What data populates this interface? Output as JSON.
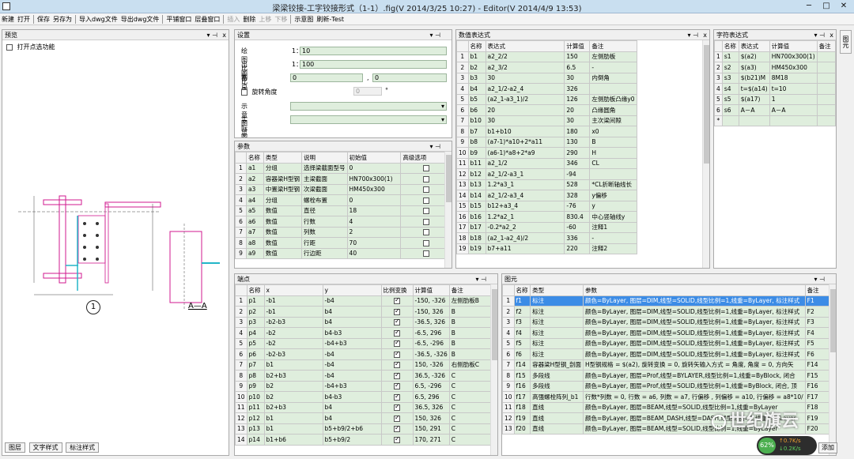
{
  "window": {
    "title": "梁梁铰接-工字铰接形式（1-1）.fig(V 2014/3/25 10:27) - Editor(V 2014/4/9 13:53)"
  },
  "menu": {
    "items": [
      {
        "label": "新建",
        "enabled": true
      },
      {
        "label": "打开",
        "enabled": true
      },
      {
        "sep": true
      },
      {
        "label": "保存",
        "enabled": true
      },
      {
        "label": "另存为",
        "enabled": true
      },
      {
        "sep": true
      },
      {
        "label": "导入dwg文件",
        "enabled": true
      },
      {
        "label": "导出dwg文件",
        "enabled": true
      },
      {
        "sep": true
      },
      {
        "label": "平铺窗口",
        "enabled": true
      },
      {
        "label": "层叠窗口",
        "enabled": true
      },
      {
        "sep": true
      },
      {
        "label": "插入",
        "enabled": false
      },
      {
        "label": "删除",
        "enabled": true
      },
      {
        "label": "上移",
        "enabled": false
      },
      {
        "label": "下移",
        "enabled": false
      },
      {
        "sep": true
      },
      {
        "label": "示意图",
        "enabled": true
      },
      {
        "label": "刷新-Test",
        "enabled": true
      }
    ]
  },
  "preview": {
    "title": "预览",
    "checkbox_label": "打开点选功能",
    "left_caption": "1",
    "right_caption": "A—A",
    "bottom_tabs": [
      "图层",
      "文字样式",
      "标注样式"
    ]
  },
  "settings": {
    "title": "设置",
    "draw_scale_label": "绘图比例",
    "draw_scale_prefix": "1：",
    "draw_scale_value": "10",
    "out_scale_label": "出图比例",
    "out_scale_prefix": "1：",
    "out_scale_value": "100",
    "base_label": "基点",
    "base_x": "0",
    "base_sep": ",",
    "base_y": "0",
    "rotate_label": "旋转角度",
    "rotate_value": "0",
    "rotate_unit": "°",
    "schematic_label": "示意图显示编号",
    "actual_label": "实际图显示编号"
  },
  "params": {
    "title": "参数",
    "columns": [
      "名称",
      "类型",
      "说明",
      "初始值",
      "高级选项"
    ],
    "rows": [
      [
        "1",
        "a1",
        "分组",
        "选择梁截面型号",
        "0"
      ],
      [
        "2",
        "a2",
        "容器梁H型钢",
        "主梁截面",
        "HN700x300(1)"
      ],
      [
        "3",
        "a3",
        "中置梁H型钢",
        "次梁截面",
        "HM450x300"
      ],
      [
        "4",
        "a4",
        "分组",
        "螺栓布置",
        "0"
      ],
      [
        "5",
        "a5",
        "数值",
        "直径",
        "18"
      ],
      [
        "6",
        "a6",
        "数值",
        "行数",
        "4"
      ],
      [
        "7",
        "a7",
        "数值",
        "列数",
        "2"
      ],
      [
        "8",
        "a8",
        "数值",
        "行距",
        "70"
      ],
      [
        "9",
        "a9",
        "数值",
        "行边距",
        "40"
      ]
    ]
  },
  "numexpr": {
    "title": "数值表达式",
    "columns": [
      "名称",
      "表达式",
      "计算值",
      "备注"
    ],
    "rows": [
      [
        "1",
        "b1",
        "a2_2/2",
        "150",
        "左侧肋板"
      ],
      [
        "2",
        "b2",
        "a2_3/2",
        "6.5",
        "-"
      ],
      [
        "3",
        "b3",
        "30",
        "30",
        "内倒角"
      ],
      [
        "4",
        "b4",
        "a2_1/2-a2_4",
        "326",
        ""
      ],
      [
        "5",
        "b5",
        "(a2_1-a3_1)/2",
        "126",
        "左侧肋板凸缘y0"
      ],
      [
        "6",
        "b6",
        "20",
        "20",
        "凸缘圆角"
      ],
      [
        "7",
        "b10",
        "30",
        "30",
        "主次梁间隙"
      ],
      [
        "8",
        "b7",
        "b1+b10",
        "180",
        "x0"
      ],
      [
        "9",
        "b8",
        "(a7-1)*a10+2*a11",
        "130",
        "B"
      ],
      [
        "10",
        "b9",
        "(a6-1)*a8+2*a9",
        "290",
        "H"
      ],
      [
        "11",
        "b11",
        "a2_1/2",
        "346",
        "CL"
      ],
      [
        "12",
        "b12",
        "a2_1/2-a3_1",
        "-94",
        ""
      ],
      [
        "13",
        "b13",
        "1.2*a3_1",
        "528",
        "*CL折断轴线长"
      ],
      [
        "14",
        "b14",
        "a2_1/2-a3_4",
        "328",
        "y偏移"
      ],
      [
        "15",
        "b15",
        "b12+a3_4",
        "-76",
        "y"
      ],
      [
        "16",
        "b16",
        "1.2*a2_1",
        "830.4",
        "中心竖轴线y"
      ],
      [
        "17",
        "b17",
        "-0.2*a2_2",
        "-60",
        "注释1"
      ],
      [
        "18",
        "b18",
        "(a2_1-a2_4)/2",
        "336",
        "-"
      ],
      [
        "19",
        "b19",
        "b7+a11",
        "220",
        "注释2"
      ]
    ]
  },
  "strexpr": {
    "title": "字符表达式",
    "columns": [
      "名称",
      "表达式",
      "计算值",
      "备注"
    ],
    "rows": [
      [
        "1",
        "s1",
        "$(a2)",
        "HN700x300(1)",
        ""
      ],
      [
        "2",
        "s2",
        "$(a3)",
        "HM450x300",
        ""
      ],
      [
        "3",
        "s3",
        "$(b21)M",
        "8M18",
        ""
      ],
      [
        "4",
        "s4",
        "t=$(a14)",
        "t=10",
        ""
      ],
      [
        "5",
        "s5",
        "$(a17)",
        "1",
        ""
      ],
      [
        "6",
        "s6",
        "A－A",
        "A－A",
        ""
      ],
      [
        "*",
        "",
        "",
        "",
        ""
      ]
    ]
  },
  "side_tab": {
    "label": "图元"
  },
  "points": {
    "title": "端点",
    "columns": [
      "名称",
      "x",
      "y",
      "比例变换",
      "计算值",
      "备注"
    ],
    "rows": [
      [
        "1",
        "p1",
        "-b1",
        "-b4",
        true,
        "-150, -326",
        "左侧肋板B"
      ],
      [
        "2",
        "p2",
        "-b1",
        "b4",
        true,
        "-150, 326",
        "B"
      ],
      [
        "3",
        "p3",
        "-b2-b3",
        "b4",
        true,
        "-36.5, 326",
        "B"
      ],
      [
        "4",
        "p4",
        "-b2",
        "b4-b3",
        true,
        "-6.5, 296",
        "B"
      ],
      [
        "5",
        "p5",
        "-b2",
        "-b4+b3",
        true,
        "-6.5, -296",
        "B"
      ],
      [
        "6",
        "p6",
        "-b2-b3",
        "-b4",
        true,
        "-36.5, -326",
        "B"
      ],
      [
        "7",
        "p7",
        "b1",
        "-b4",
        true,
        "150, -326",
        "右侧肋板C"
      ],
      [
        "8",
        "p8",
        "b2+b3",
        "-b4",
        true,
        "36.5, -326",
        "C"
      ],
      [
        "9",
        "p9",
        "b2",
        "-b4+b3",
        true,
        "6.5, -296",
        "C"
      ],
      [
        "10",
        "p10",
        "b2",
        "b4-b3",
        true,
        "6.5, 296",
        "C"
      ],
      [
        "11",
        "p11",
        "b2+b3",
        "b4",
        true,
        "36.5, 326",
        "C"
      ],
      [
        "12",
        "p12",
        "b1",
        "b4",
        true,
        "150, 326",
        "C"
      ],
      [
        "13",
        "p13",
        "b1",
        "b5+b9/2+b6",
        true,
        "150, 291",
        "C"
      ],
      [
        "14",
        "p14",
        "b1+b6",
        "b5+b9/2",
        true,
        "170, 271",
        "C"
      ]
    ]
  },
  "elements": {
    "title": "图元",
    "columns": [
      "名称",
      "类型",
      "参数",
      "备注"
    ],
    "rows": [
      [
        "1",
        "f1",
        "标注",
        "颜色=ByLayer, 图层=DIM,线型=SOLID,线型比例=1,线重=ByLayer, 标注样式",
        "F1"
      ],
      [
        "2",
        "f2",
        "标注",
        "颜色=ByLayer, 图层=DIM,线型=SOLID,线型比例=1,线重=ByLayer, 标注样式",
        "F2"
      ],
      [
        "3",
        "f3",
        "标注",
        "颜色=ByLayer, 图层=DIM,线型=SOLID,线型比例=1,线重=ByLayer, 标注样式",
        "F3"
      ],
      [
        "4",
        "f4",
        "标注",
        "颜色=ByLayer, 图层=DIM,线型=SOLID,线型比例=1,线重=ByLayer, 标注样式",
        "F4"
      ],
      [
        "5",
        "f5",
        "标注",
        "颜色=ByLayer, 图层=DIM,线型=SOLID,线型比例=1,线重=ByLayer, 标注样式",
        "F5"
      ],
      [
        "6",
        "f6",
        "标注",
        "颜色=ByLayer, 图层=DIM,线型=SOLID,线型比例=1,线重=ByLayer, 标注样式",
        "F6"
      ],
      [
        "7",
        "f14",
        "容器梁H型钢_剖面",
        "H型钢规格 = $(a2), 旋转变换 = 0, 旋转矢输入方式 = 角度, 角度 = 0, 方向矢",
        "F14"
      ],
      [
        "8",
        "f15",
        "多段线",
        "颜色=ByLayer, 图层=Prof,线型=BYLAYER,线型比例=1,线重=ByBlock, 闭合",
        "F15"
      ],
      [
        "9",
        "f16",
        "多段线",
        "颜色=ByLayer, 图层=Prof,线型=SOLID,线型比例=1,线重=ByBlock, 闭合, 顶",
        "F16"
      ],
      [
        "10",
        "f17",
        "高强螺栓阵列_b1",
        "行数*列数 = 0, 行数 = a6, 列数 = a7, 行偏移 , 列偏移 = a10, 行偏移 = a8*10/",
        "F17"
      ],
      [
        "11",
        "f18",
        "直线",
        "颜色=ByLayer, 图层=BEAM,线型=SOLID,线型比例=1,线重=ByLayer",
        "F18"
      ],
      [
        "12",
        "f19",
        "直线",
        "颜色=ByLayer, 图层=BEAM_DASH,线型=DASH,线型比例=1,线重=ByLayer",
        "F19"
      ],
      [
        "13",
        "f20",
        "直线",
        "颜色=ByLayer, 图层=BEAM,线型=SOLID,线型比例=1,线重=ByLayer",
        "F20"
      ]
    ]
  },
  "watermark": {
    "text": "世纪旗云"
  },
  "tray": {
    "percent": "62%",
    "up": "0.7K/s",
    "down": "0.2K/s",
    "add_label": "添加"
  },
  "colors": {
    "cell_bg": "#dfeedd",
    "selected_row": "#3c8ce6",
    "drawing_magenta": "#d0198f",
    "drawing_cyan": "#22b5c8"
  }
}
